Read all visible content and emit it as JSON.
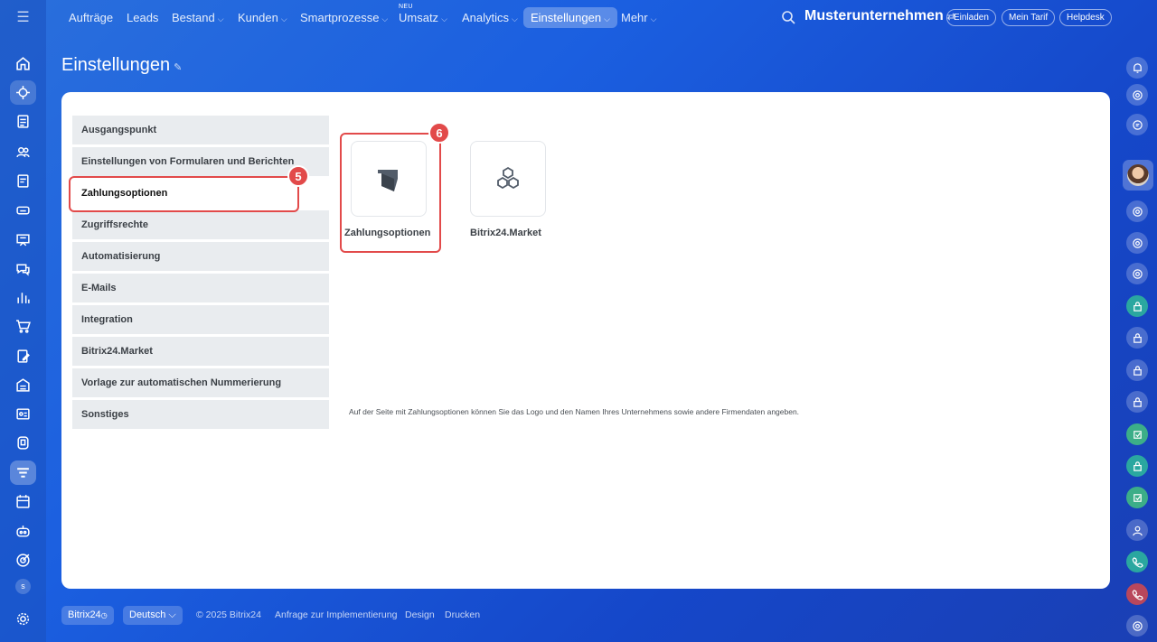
{
  "topnav": {
    "items": [
      {
        "label": "Aufträge",
        "chevron": false
      },
      {
        "label": "Leads",
        "chevron": false
      },
      {
        "label": "Bestand",
        "chevron": true
      },
      {
        "label": "Kunden",
        "chevron": true
      },
      {
        "label": "Smartprozesse",
        "chevron": true
      },
      {
        "label": "Umsatz",
        "chevron": true
      },
      {
        "label": "Analytics",
        "chevron": true
      },
      {
        "label": "Einstellungen",
        "chevron": true,
        "active": true
      },
      {
        "label": "Mehr",
        "chevron": true
      }
    ],
    "neu_badge": "NEU",
    "company": "Musterunternehmen",
    "buttons": {
      "invite": "Einladen",
      "plan": "Mein Tarif",
      "help": "Helpdesk"
    }
  },
  "page": {
    "title": "Einstellungen"
  },
  "menu": {
    "items": [
      "Ausgangspunkt",
      "Einstellungen von Formularen und Berichten",
      "Zahlungsoptionen",
      "Zugriffsrechte",
      "Automatisierung",
      "E-Mails",
      "Integration",
      "Bitrix24.Market",
      "Vorlage zur automatischen Nummerierung",
      "Sonstiges"
    ],
    "selected": "Zahlungsoptionen"
  },
  "tiles": [
    {
      "label": "Zahlungsoptionen",
      "icon": "payment-options-icon"
    },
    {
      "label": "Bitrix24.Market",
      "icon": "market-cubes-icon"
    }
  ],
  "steps": {
    "five": "5",
    "six": "6"
  },
  "description": "Auf der Seite mit Zahlungsoptionen können Sie das Logo und den Namen Ihres Unternehmens sowie andere Firmendaten angeben.",
  "footer": {
    "brand": "Bitrix24",
    "language": "Deutsch",
    "copyright": "© 2025 Bitrix24",
    "links": [
      "Anfrage zur Implementierung",
      "Design",
      "Drucken"
    ]
  },
  "colors": {
    "accent": "#e24a4a",
    "background": "#1b5fe0"
  }
}
